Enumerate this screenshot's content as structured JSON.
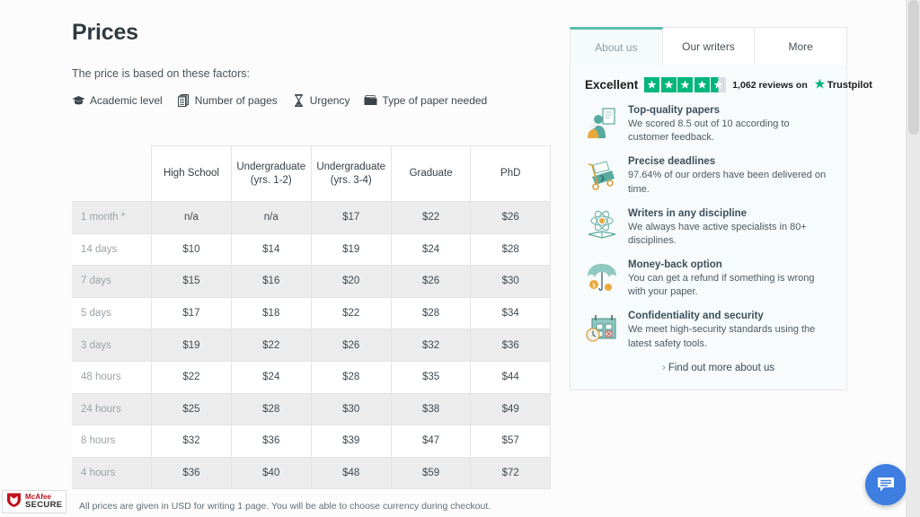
{
  "page": {
    "title": "Prices",
    "factors_intro": "The price is based on these factors:",
    "factors": [
      {
        "icon": "graduation-cap-icon",
        "label": "Academic level"
      },
      {
        "icon": "pages-stack-icon",
        "label": "Number of pages"
      },
      {
        "icon": "hourglass-icon",
        "label": "Urgency"
      },
      {
        "icon": "folder-icon",
        "label": "Type of paper needed"
      }
    ],
    "table_note": "All prices are given in USD for writing 1 page. You will be able to choose currency during checkout."
  },
  "table": {
    "corner_label": "",
    "columns": [
      "High School",
      "Undergraduate (yrs. 1-2)",
      "Undergraduate (yrs. 3-4)",
      "Graduate",
      "PhD"
    ],
    "columns_lines": [
      [
        "High School"
      ],
      [
        "Undergraduate",
        "(yrs. 1-2)"
      ],
      [
        "Undergraduate",
        "(yrs. 3-4)"
      ],
      [
        "Graduate"
      ],
      [
        "PhD"
      ]
    ],
    "rows": [
      {
        "deadline": "1 month *",
        "values": [
          "n/a",
          "n/a",
          "$17",
          "$22",
          "$26"
        ]
      },
      {
        "deadline": "14 days",
        "values": [
          "$10",
          "$14",
          "$19",
          "$24",
          "$28"
        ]
      },
      {
        "deadline": "7 days",
        "values": [
          "$15",
          "$16",
          "$20",
          "$26",
          "$30"
        ]
      },
      {
        "deadline": "5 days",
        "values": [
          "$17",
          "$18",
          "$22",
          "$28",
          "$34"
        ]
      },
      {
        "deadline": "3 days",
        "values": [
          "$19",
          "$22",
          "$26",
          "$32",
          "$36"
        ]
      },
      {
        "deadline": "48 hours",
        "values": [
          "$22",
          "$24",
          "$28",
          "$35",
          "$44"
        ]
      },
      {
        "deadline": "24 hours",
        "values": [
          "$25",
          "$28",
          "$30",
          "$38",
          "$49"
        ]
      },
      {
        "deadline": "8 hours",
        "values": [
          "$32",
          "$36",
          "$39",
          "$47",
          "$57"
        ]
      },
      {
        "deadline": "4 hours",
        "values": [
          "$36",
          "$40",
          "$48",
          "$59",
          "$72"
        ]
      }
    ]
  },
  "sidebar": {
    "tabs": [
      {
        "label": "About us",
        "active": true
      },
      {
        "label": "Our writers",
        "active": false
      },
      {
        "label": "More",
        "active": false
      }
    ],
    "trustpilot": {
      "rating_word": "Excellent",
      "stars_full": 4,
      "stars_half": 1,
      "reviews_text": "1,062 reviews on",
      "brand": "Trustpilot",
      "star_color": "#00b67a"
    },
    "features": [
      {
        "icon": "quality-papers-icon",
        "title": "Top-quality papers",
        "desc": "We scored 8.5 out of 10 according to customer feedback."
      },
      {
        "icon": "deadline-cart-icon",
        "title": "Precise deadlines",
        "desc": "97.64% of our orders have been delivered on time."
      },
      {
        "icon": "disciplines-book-icon",
        "title": "Writers in any discipline",
        "desc": "We always have active specialists in 80+ disciplines."
      },
      {
        "icon": "umbrella-coins-icon",
        "title": "Money-back option",
        "desc": "You can get a refund if something is wrong with your paper."
      },
      {
        "icon": "security-lock-icon",
        "title": "Confidentiality and security",
        "desc": "We meet high-security standards using the latest safety tools."
      }
    ],
    "find_more_chevron": "›",
    "find_more_label": "Find out more about us"
  },
  "badges": {
    "mcafee_line1": "McAfee",
    "mcafee_line2": "SECURE"
  },
  "chat": {
    "icon": "chat-bubble-icon",
    "color": "#3d7ee0"
  },
  "colors": {
    "accent_teal": "#5bbfae",
    "trustpilot_green": "#00b67a",
    "chat_blue": "#3d7ee0",
    "mcafee_red": "#b5121b"
  }
}
